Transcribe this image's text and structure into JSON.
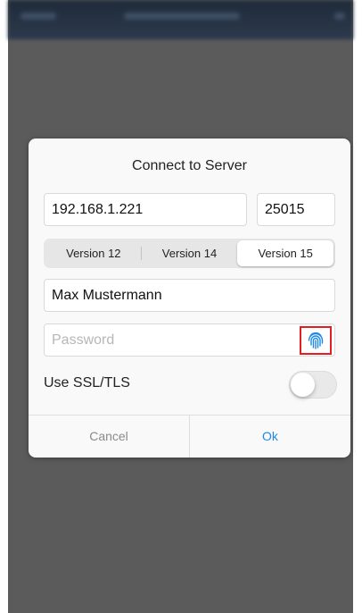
{
  "dialog": {
    "title": "Connect to Server",
    "host_value": "192.168.1.221",
    "port_value": "25015",
    "versions": [
      "Version 12",
      "Version 14",
      "Version 15"
    ],
    "selected_version": "Version 15",
    "username_value": "Max Mustermann",
    "password_placeholder": "Password",
    "ssl_label": "Use SSL/TLS",
    "ssl_enabled": false,
    "cancel_label": "Cancel",
    "ok_label": "Ok"
  },
  "icons": {
    "biometric": "fingerprint-icon"
  },
  "colors": {
    "accent": "#1e88e5",
    "highlight_box": "#e02020",
    "overlay": "#5b5b5b"
  }
}
